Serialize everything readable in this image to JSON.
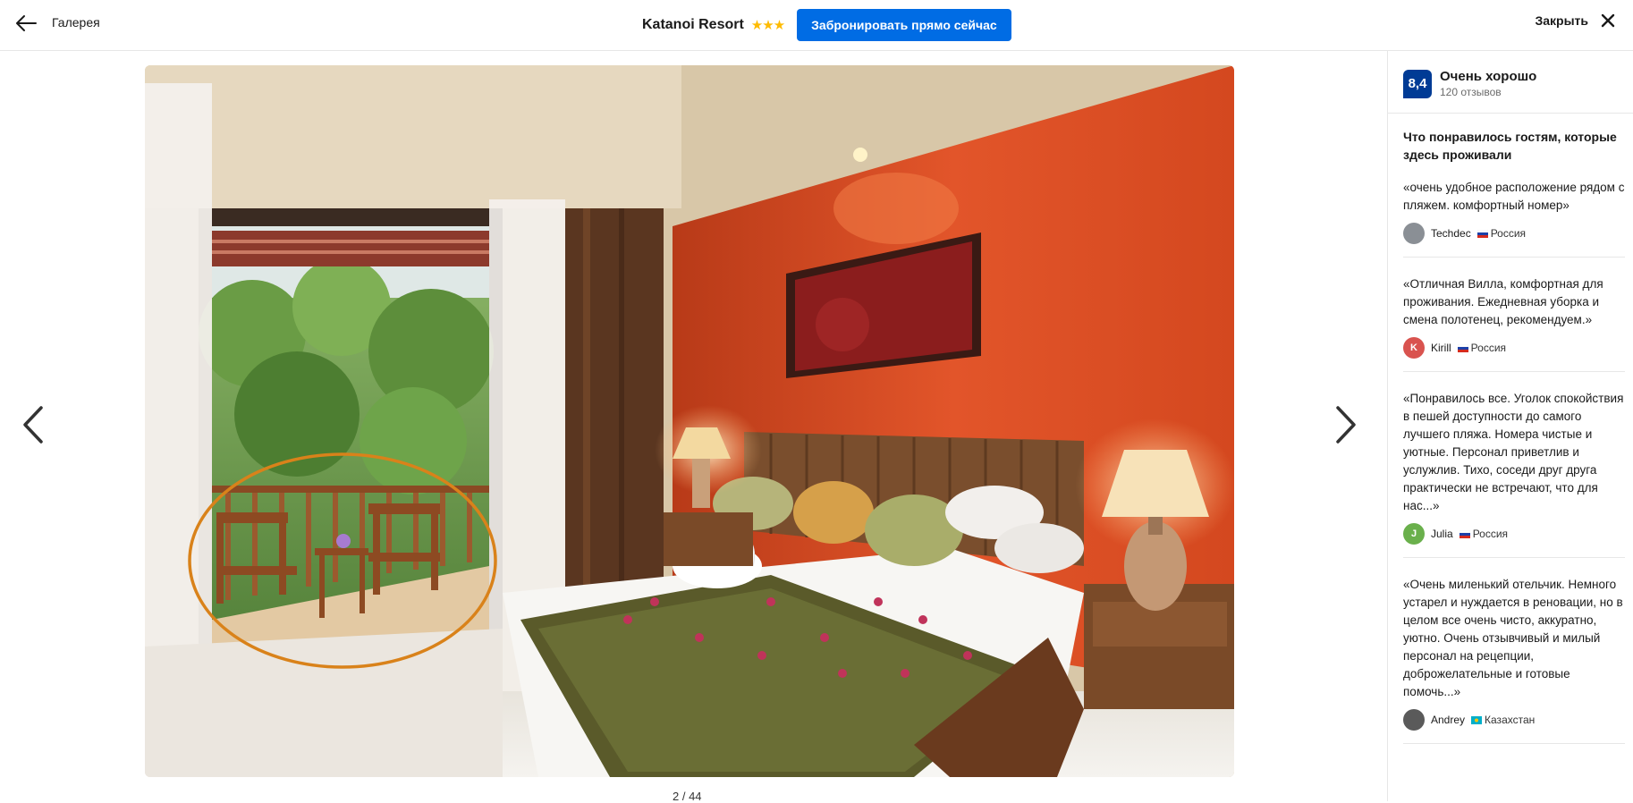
{
  "header": {
    "back_label": "Галерея",
    "hotel_name": "Katanoi Resort",
    "stars": "★★★",
    "book_button": "Забронировать прямо сейчас",
    "close_label": "Закрыть"
  },
  "gallery": {
    "counter": "2 / 44"
  },
  "sidebar": {
    "score": "8,4",
    "score_label": "Очень хорошо",
    "review_count": "120 отзывов",
    "liked_title": "Что понравилось гостям, которые здесь проживали",
    "reviews": [
      {
        "text": "«очень удобное расположение рядом с пляжем. комфортный номер»",
        "author": "Techdec",
        "country": "Россия",
        "avatar": "",
        "avatar_color": "#8a8f95",
        "flag": "ru"
      },
      {
        "text": "«Отличная Вилла, комфортная для проживания. Ежедневная уборка и смена полотенец, рекомендуем.»",
        "author": "Kirill",
        "country": "Россия",
        "avatar": "K",
        "avatar_color": "#d9534f",
        "flag": "ru"
      },
      {
        "text": "«Понравилось все. Уголок спокойствия в пешей доступности до самого лучшего пляжа. Номера чистые и уютные. Персонал приветлив и услужлив. Тихо, соседи друг друга практически не встречают, что для нас...»",
        "author": "Julia",
        "country": "Россия",
        "avatar": "J",
        "avatar_color": "#6ab04c",
        "flag": "ru"
      },
      {
        "text": "«Очень миленький отельчик. Немного устарел и нуждается в реновации, но в целом все очень чисто, аккуратно, уютно. Очень отзывчивый и милый персонал на рецепции, доброжелательные и готовые помочь...»",
        "author": "Andrey",
        "country": "Казахстан",
        "avatar": "",
        "avatar_color": "#5a5a5a",
        "flag": "kz"
      }
    ]
  },
  "colors": {
    "accent": "#006ce4",
    "score_badge": "#003b95",
    "stars": "#febb02",
    "highlight_circle": "#d9821a"
  }
}
